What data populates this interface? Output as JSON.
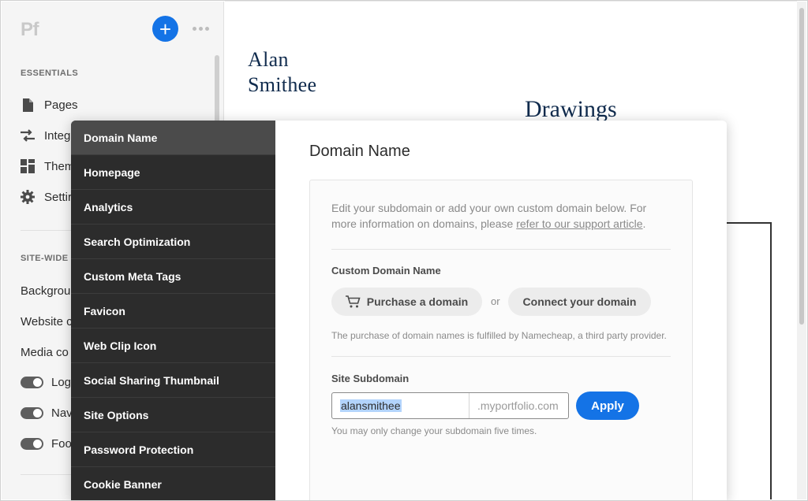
{
  "sidebar": {
    "logo": "Pf",
    "add_label": "+",
    "essentials_heading": "ESSENTIALS",
    "essentials": [
      {
        "label": "Pages",
        "icon": "page-icon"
      },
      {
        "label": "Integ",
        "icon": "swap-arrows-icon"
      },
      {
        "label": "Them",
        "icon": "layout-grid-icon"
      },
      {
        "label": "Settir",
        "icon": "gear-icon"
      }
    ],
    "sitewide_heading": "SITE-WIDE",
    "sitewide": [
      {
        "label": "Backgrou"
      },
      {
        "label": "Website c"
      },
      {
        "label": "Media co"
      }
    ],
    "toggles": [
      {
        "label": "Log",
        "on": true
      },
      {
        "label": "Nav",
        "on": true
      },
      {
        "label": "Foo",
        "on": true
      }
    ]
  },
  "canvas": {
    "name_line1": "Alan",
    "name_line2": "Smithee",
    "gallery_title": "Drawings"
  },
  "modal": {
    "nav": [
      {
        "label": "Domain Name",
        "active": true
      },
      {
        "label": "Homepage"
      },
      {
        "label": "Analytics"
      },
      {
        "label": "Search Optimization"
      },
      {
        "label": "Custom Meta Tags"
      },
      {
        "label": "Favicon"
      },
      {
        "label": "Web Clip Icon"
      },
      {
        "label": "Social Sharing Thumbnail"
      },
      {
        "label": "Site Options"
      },
      {
        "label": "Password Protection"
      },
      {
        "label": "Cookie Banner"
      }
    ],
    "title": "Domain Name",
    "intro_text": "Edit your subdomain or add your own custom domain below. For more information on domains, please ",
    "intro_link": "refer to our support article",
    "intro_end": ".",
    "custom_domain_label": "Custom Domain Name",
    "purchase_button": "Purchase a domain",
    "or_text": "or",
    "connect_button": "Connect your domain",
    "purchase_note": "The purchase of domain names is fulfilled by Namecheap, a third party provider.",
    "subdomain_label": "Site Subdomain",
    "subdomain_value": "alansmithee",
    "subdomain_suffix": ".myportfolio.com",
    "apply_button": "Apply",
    "subdomain_note": "You may only change your subdomain five times."
  },
  "colors": {
    "accent": "#1473e6",
    "nav_bg": "#2c2c2c",
    "nav_active": "#4b4b4b",
    "heading_navy": "#102b4d"
  }
}
